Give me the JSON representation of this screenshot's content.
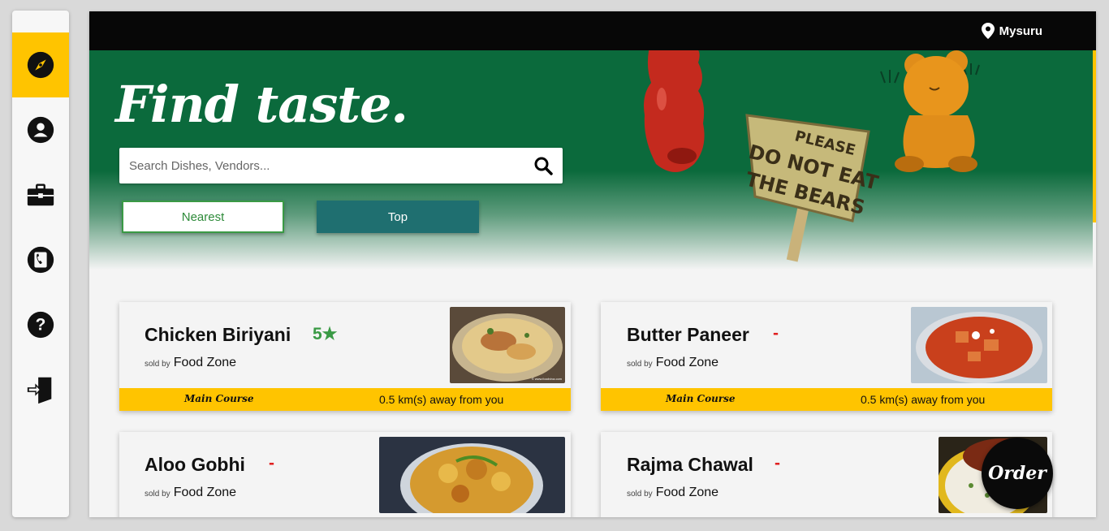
{
  "sidebar": {
    "items": [
      {
        "name": "explore",
        "icon": "compass-icon",
        "active": true
      },
      {
        "name": "profile",
        "icon": "user-icon",
        "active": false
      },
      {
        "name": "business",
        "icon": "briefcase-icon",
        "active": false
      },
      {
        "name": "contact",
        "icon": "phone-icon",
        "active": false
      },
      {
        "name": "help",
        "icon": "help-icon",
        "active": false
      },
      {
        "name": "logout",
        "icon": "logout-icon",
        "active": false
      }
    ],
    "accent_color": "#ffc400"
  },
  "topbar": {
    "location": "Mysuru",
    "location_icon": "map-pin-icon"
  },
  "hero": {
    "title": "Find taste.",
    "search_placeholder": "Search Dishes, Vendors...",
    "search_icon": "search-icon",
    "filter_nearest": "Nearest",
    "filter_top": "Top",
    "sign_line1": "PLEASE",
    "sign_line2": "DO NOT EAT",
    "sign_line3": "THE BEARS",
    "bg_color": "#0b6a3c"
  },
  "cards": [
    {
      "dish": "Chicken Biriyani",
      "rating": "5★",
      "sold_by": "sold by",
      "vendor": "Food Zone",
      "category": "Main Course",
      "distance": "0.5 km(s) away from you",
      "image_watermark": "© www.foodviva.com"
    },
    {
      "dish": "Butter Paneer",
      "rating": "-",
      "sold_by": "sold by",
      "vendor": "Food Zone",
      "category": "Main Course",
      "distance": "0.5 km(s) away from you"
    },
    {
      "dish": "Aloo Gobhi",
      "rating": "-",
      "sold_by": "sold by",
      "vendor": "Food Zone"
    },
    {
      "dish": "Rajma Chawal",
      "rating": "-",
      "sold_by": "sold by",
      "vendor": "Food Zone"
    }
  ],
  "order_button": "Order"
}
